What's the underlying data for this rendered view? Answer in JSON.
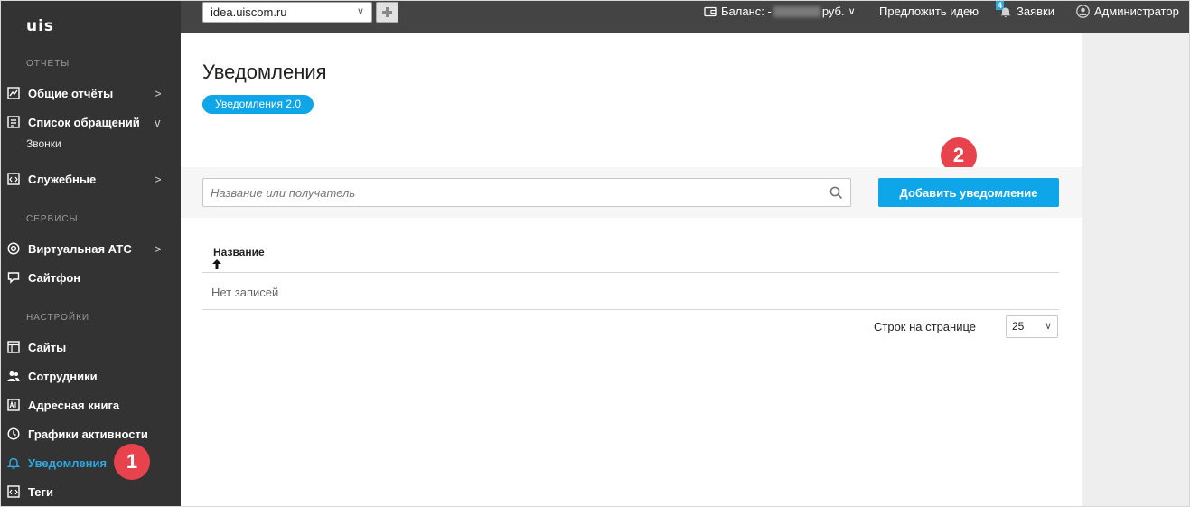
{
  "sidebar": {
    "logo": "uis",
    "sections": {
      "reports": "ОТЧЕТЫ",
      "services": "СЕРВИСЫ",
      "settings": "НАСТРОЙКИ"
    },
    "items": {
      "general_reports": "Общие отчёты",
      "appeals_list": "Список обращений",
      "calls": "Звонки",
      "service": "Служебные",
      "virtual_pbx": "Виртуальная АТС",
      "sitephone": "Сайтфон",
      "sites": "Сайты",
      "employees": "Сотрудники",
      "address_book": "Адресная книга",
      "activity_schedules": "Графики активности",
      "notifications": "Уведомления",
      "tags": "Теги"
    },
    "chevrons": {
      "right": ">",
      "down": "v"
    }
  },
  "topbar": {
    "site": "idea.uiscom.ru",
    "balance_label": "Баланс: -",
    "balance_unit": "руб.",
    "suggest_idea": "Предложить идею",
    "requests_count": "4",
    "requests": "Заявки",
    "admin": "Администратор"
  },
  "main": {
    "title": "Уведомления",
    "version_pill": "Уведомления 2.0",
    "search_placeholder": "Название или получатель",
    "add_button": "Добавить уведомление",
    "column_name": "Название",
    "empty": "Нет записей",
    "rows_per_page_label": "Строк на странице",
    "rows_per_page_value": "25"
  },
  "annotations": {
    "one": "1",
    "two": "2"
  },
  "colors": {
    "sidebar": "#333333",
    "topbar": "#444444",
    "accent": "#0ea5e9",
    "marker": "#e8424d"
  }
}
